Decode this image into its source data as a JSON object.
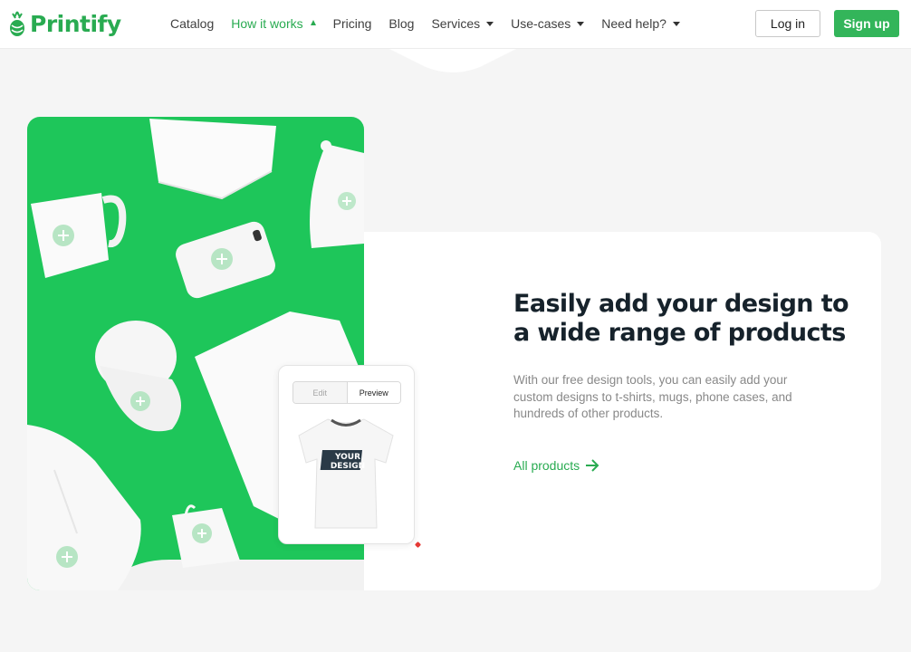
{
  "brand": {
    "name": "Printify",
    "accent": "#29ab51",
    "hero_green": "#1ec65a"
  },
  "nav": {
    "items": [
      {
        "label": "Catalog",
        "dropdown": false,
        "active": false
      },
      {
        "label": "How it works",
        "dropdown": true,
        "active": true
      },
      {
        "label": "Pricing",
        "dropdown": false,
        "active": false
      },
      {
        "label": "Blog",
        "dropdown": false,
        "active": false
      },
      {
        "label": "Services",
        "dropdown": true,
        "active": false
      },
      {
        "label": "Use-cases",
        "dropdown": true,
        "active": false
      },
      {
        "label": "Need help?",
        "dropdown": true,
        "active": false
      }
    ],
    "login": "Log in",
    "signup": "Sign up"
  },
  "feature": {
    "headline": "Easily add your design to a wide range of products",
    "description": "With our free design tools, you can easily add your custom designs to t-shirts, mugs, phone cases, and hundreds of other products.",
    "link": "All products",
    "preview": {
      "tab_edit": "Edit",
      "tab_preview": "Preview",
      "selected": "Preview",
      "shirt_text": "YOUR DESIGN"
    }
  }
}
